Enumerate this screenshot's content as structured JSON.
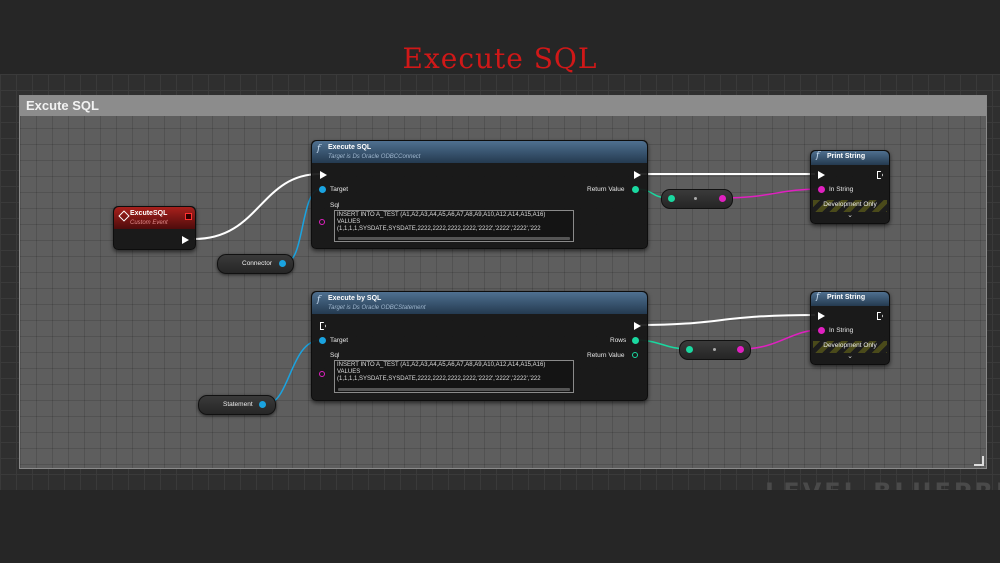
{
  "page_title": "Execute SQL",
  "comment_title": "Excute SQL",
  "watermark": "LEVEL BLUEPRINT",
  "event_node": {
    "title": "ExcuteSQL",
    "subtitle": "Custom Event"
  },
  "connector_var": {
    "label": "Connector"
  },
  "statement_var": {
    "label": "Statement"
  },
  "execute_sql": {
    "title": "Execute SQL",
    "subtitle": "Target is Ds Oracle ODBCConnect",
    "target_label": "Target",
    "sql_label": "Sql",
    "return_label": "Return Value",
    "sql_text": "INSERT INTO A_TEST (A1,A2,A3,A4,A5,A6,A7,A8,A9,A10,A12,A14,A15,A16)\nVALUES\n(1,1,1,1,SYSDATE,SYSDATE,2222,2222,2222,2222,'2222','2222','2222','222"
  },
  "execute_by_sql": {
    "title": "Execute by SQL",
    "subtitle": "Target is Ds Oracle ODBCStatement",
    "target_label": "Target",
    "sql_label": "Sql",
    "rows_label": "Rows",
    "return_label": "Return Value",
    "sql_text": "INSERT INTO A_TEST (A1,A2,A3,A4,A5,A6,A7,A8,A9,A10,A12,A14,A15,A16)\nVALUES\n(1,1,1,1,SYSDATE,SYSDATE,2222,2222,2222,2222,'2222','2222','2222','222"
  },
  "print_string_1": {
    "title": "Print String",
    "in_label": "In String",
    "dev_label": "Development Only"
  },
  "print_string_2": {
    "title": "Print String",
    "in_label": "In String",
    "dev_label": "Development Only"
  },
  "colors": {
    "title_red": "#d01818",
    "object_pin": "#1aa3e0",
    "string_pin": "#e020c0",
    "int_pin": "#1ad8a0",
    "event_red": "#a8201c"
  }
}
